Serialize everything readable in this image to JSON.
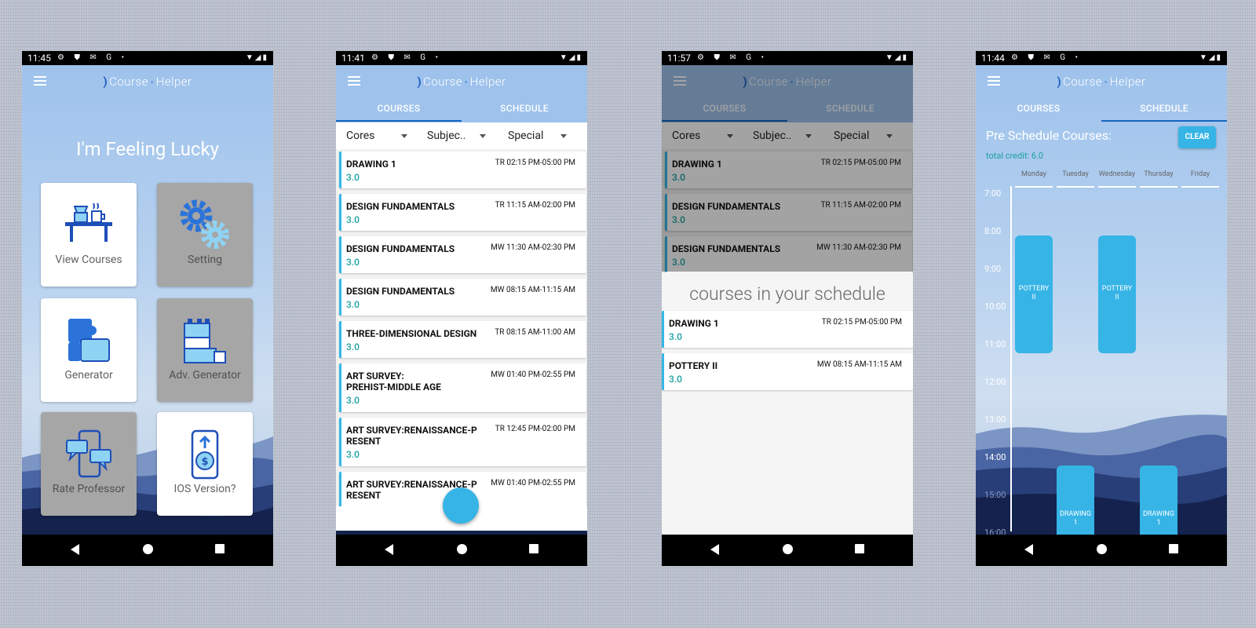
{
  "status": {
    "icons": "⚙ ⛊ ✉ G •",
    "right": "▼◢▮",
    "phone1_time": "11:45",
    "phone2_time": "11:41",
    "phone3_time": "11:57",
    "phone4_time": "11:44"
  },
  "app": {
    "logo_mark": ")",
    "logo_word1": "Course",
    "logo_dot": "•",
    "logo_word2": "Helper"
  },
  "home": {
    "headline": "I'm Feeling Lucky",
    "tiles": [
      {
        "label": "View Courses",
        "icon": "table-with-coffee-icon"
      },
      {
        "label": "Setting",
        "icon": "gears-icon"
      },
      {
        "label": "Generator",
        "icon": "puzzle-icon"
      },
      {
        "label": "Adv. Generator",
        "icon": "building-blocks-icon"
      },
      {
        "label": "Rate Professor",
        "icon": "phone-chat-icon"
      },
      {
        "label": "IOS Version?",
        "icon": "phone-dollar-icon"
      }
    ]
  },
  "tabs": {
    "courses": "COURSES",
    "schedule": "SCHEDULE"
  },
  "filters": {
    "cores": "Cores",
    "subject": "Subjec..",
    "special": "Special"
  },
  "courses": [
    {
      "name": "DRAWING 1",
      "time": "TR 02:15 PM-05:00 PM",
      "credit": "3.0"
    },
    {
      "name": "DESIGN FUNDAMENTALS",
      "time": "TR 11:15 AM-02:00 PM",
      "credit": "3.0"
    },
    {
      "name": "DESIGN FUNDAMENTALS",
      "time": "MW 11:30 AM-02:30 PM",
      "credit": "3.0"
    },
    {
      "name": "DESIGN FUNDAMENTALS",
      "time": "MW 08:15 AM-11:15 AM",
      "credit": "3.0"
    },
    {
      "name": "THREE-DIMENSIONAL DESIGN",
      "time": "TR 08:15 AM-11:00 AM",
      "credit": "3.0"
    },
    {
      "name": "ART SURVEY:\nPREHIST-MIDDLE AGE",
      "time": "MW 01:40 PM-02:55 PM",
      "credit": "3.0"
    },
    {
      "name": "ART SURVEY:RENAISSANCE-P\nRESENT",
      "time": "TR 12:45 PM-02:00 PM",
      "credit": "3.0"
    },
    {
      "name": "ART SURVEY:RENAISSANCE-P\nRESENT",
      "time": "MW 01:40 PM-02:55 PM",
      "credit": ""
    }
  ],
  "sheet": {
    "title": "courses in your schedule",
    "items": [
      {
        "name": "DRAWING 1",
        "time": "TR 02:15 PM-05:00 PM",
        "credit": "3.0"
      },
      {
        "name": "POTTERY II",
        "time": "MW 08:15 AM-11:15 AM",
        "credit": "3.0"
      }
    ]
  },
  "schedule": {
    "title": "Pre Schedule Courses:",
    "clear": "CLEAR",
    "total_credit": "total credit: 6.0",
    "days": [
      "Monday",
      "Tuesday",
      "Wednesday",
      "Thursday",
      "Friday"
    ],
    "hours": [
      "7:00",
      "8:00",
      "9:00",
      "10:00",
      "11:00",
      "12:00",
      "13:00",
      "14:00",
      "15:00",
      "16:00"
    ],
    "blocks": [
      {
        "label": "POTTERY\nII",
        "day": "Monday",
        "start": "8:15",
        "end": "11:15"
      },
      {
        "label": "POTTERY\nII",
        "day": "Wednesday",
        "start": "8:15",
        "end": "11:15"
      },
      {
        "label": "DRAWING\n1",
        "day": "Tuesday",
        "start": "14:15",
        "end": "17:00"
      },
      {
        "label": "DRAWING\n1",
        "day": "Thursday",
        "start": "14:15",
        "end": "17:00"
      }
    ]
  }
}
